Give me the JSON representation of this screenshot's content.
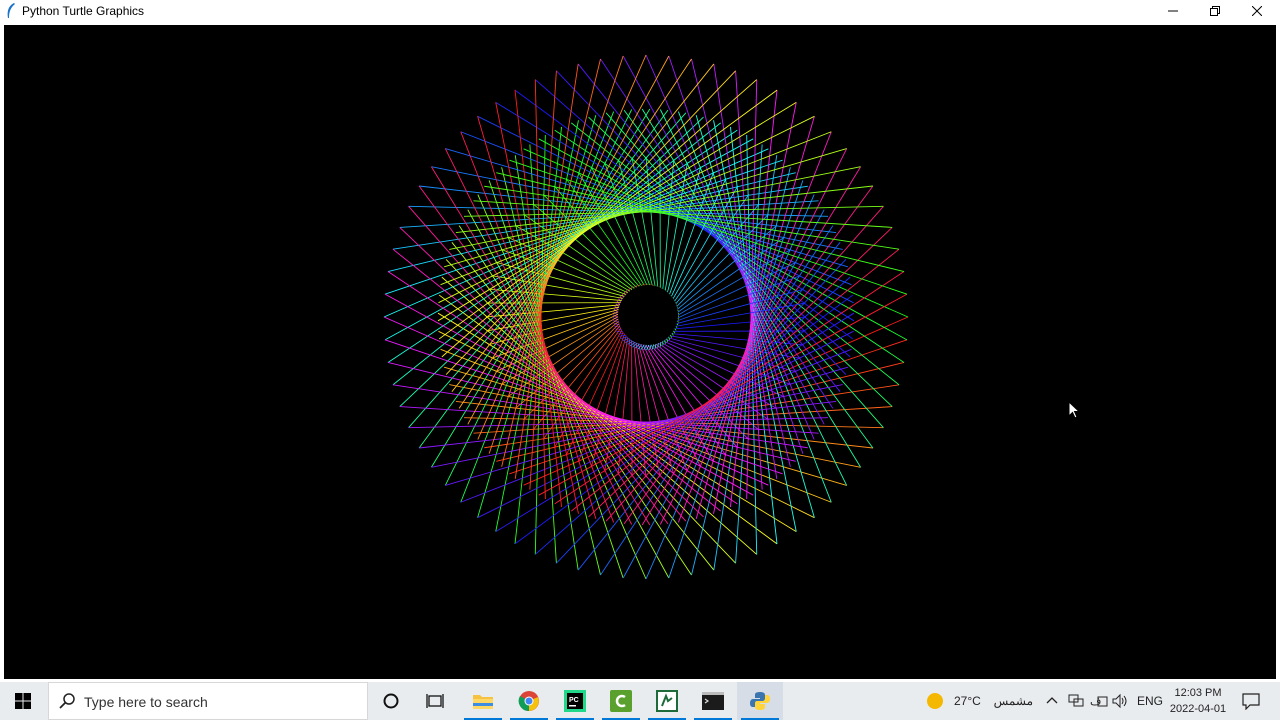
{
  "window": {
    "title": "Python Turtle Graphics",
    "icon": "feather-icon",
    "controls": [
      "minimize-icon",
      "restore-icon",
      "close-icon"
    ]
  },
  "canvas": {
    "background": "#000000",
    "drawing": "rainbow-spirograph"
  },
  "taskbar": {
    "search_placeholder": "Type here to search",
    "pinned": [
      "cortana-icon",
      "task-view-icon",
      "file-explorer-icon",
      "chrome-icon",
      "pycharm-icon",
      "camtasia-icon",
      "app-icon",
      "terminal-icon",
      "python-icon"
    ],
    "weather": {
      "temp": "27°C",
      "condition": "مشمس"
    },
    "language": "ENG",
    "clock": {
      "time": "12:03 PM",
      "date": "2022-04-01"
    }
  }
}
